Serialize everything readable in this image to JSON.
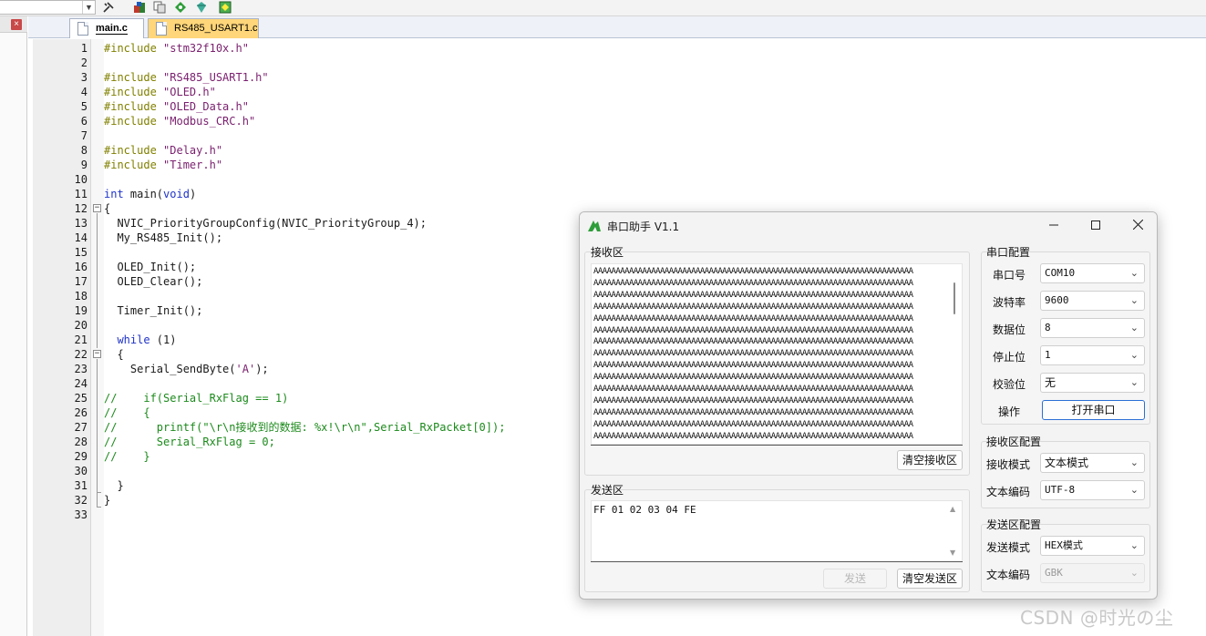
{
  "ide": {
    "tabs": [
      {
        "label": "main.c",
        "active": true
      },
      {
        "label": "RS485_USART1.c",
        "active": false
      }
    ],
    "line_numbers": [
      "1",
      "2",
      "3",
      "4",
      "5",
      "6",
      "7",
      "8",
      "9",
      "10",
      "11",
      "12",
      "13",
      "14",
      "15",
      "16",
      "17",
      "18",
      "19",
      "20",
      "21",
      "22",
      "23",
      "24",
      "25",
      "26",
      "27",
      "28",
      "29",
      "30",
      "31",
      "32",
      "33"
    ],
    "code": {
      "l1a": "#include ",
      "l1b": "\"stm32f10x.h\"",
      "l3a": "#include ",
      "l3b": "\"RS485_USART1.h\"",
      "l4a": "#include ",
      "l4b": "\"OLED.h\"",
      "l5a": "#include ",
      "l5b": "\"OLED_Data.h\"",
      "l6a": "#include ",
      "l6b": "\"Modbus_CRC.h\"",
      "l8a": "#include ",
      "l8b": "\"Delay.h\"",
      "l9a": "#include ",
      "l9b": "\"Timer.h\"",
      "l11a": "int",
      "l11b": " main(",
      "l11c": "void",
      "l11d": ")",
      "l12": "{",
      "l13": "  NVIC_PriorityGroupConfig(NVIC_PriorityGroup_4);",
      "l14": "  My_RS485_Init();",
      "l16": "  OLED_Init();",
      "l17": "  OLED_Clear();",
      "l19": "  Timer_Init();",
      "l21a": "  while",
      "l21b": " (1)",
      "l22": "  {",
      "l23a": "    Serial_SendByte(",
      "l23b": "'A'",
      "l23c": ");",
      "l25": "//    if(Serial_RxFlag == 1)",
      "l26": "//    {",
      "l27": "//      printf(\"\\r\\n接收到的数据: %x!\\r\\n\",Serial_RxPacket[0]);",
      "l28": "//      Serial_RxFlag = 0;",
      "l29": "//    }",
      "l31": "  }",
      "l32": "}"
    }
  },
  "serial": {
    "title": "串口助手 V1.1",
    "receive": {
      "label": "接收区",
      "text": "AAAAAAAAAAAAAAAAAAAAAAAAAAAAAAAAAAAAAAAAAAAAAAAAAAAAAAAAAAAAAAAAAAAAAAAA\nAAAAAAAAAAAAAAAAAAAAAAAAAAAAAAAAAAAAAAAAAAAAAAAAAAAAAAAAAAAAAAAAAAAAAAAA\nAAAAAAAAAAAAAAAAAAAAAAAAAAAAAAAAAAAAAAAAAAAAAAAAAAAAAAAAAAAAAAAAAAAAAAAA\nAAAAAAAAAAAAAAAAAAAAAAAAAAAAAAAAAAAAAAAAAAAAAAAAAAAAAAAAAAAAAAAAAAAAAAAA\nAAAAAAAAAAAAAAAAAAAAAAAAAAAAAAAAAAAAAAAAAAAAAAAAAAAAAAAAAAAAAAAAAAAAAAAA\nAAAAAAAAAAAAAAAAAAAAAAAAAAAAAAAAAAAAAAAAAAAAAAAAAAAAAAAAAAAAAAAAAAAAAAAA\nAAAAAAAAAAAAAAAAAAAAAAAAAAAAAAAAAAAAAAAAAAAAAAAAAAAAAAAAAAAAAAAAAAAAAAAA\nAAAAAAAAAAAAAAAAAAAAAAAAAAAAAAAAAAAAAAAAAAAAAAAAAAAAAAAAAAAAAAAAAAAAAAAA\nAAAAAAAAAAAAAAAAAAAAAAAAAAAAAAAAAAAAAAAAAAAAAAAAAAAAAAAAAAAAAAAAAAAAAAAA\nAAAAAAAAAAAAAAAAAAAAAAAAAAAAAAAAAAAAAAAAAAAAAAAAAAAAAAAAAAAAAAAAAAAAAAAA\nAAAAAAAAAAAAAAAAAAAAAAAAAAAAAAAAAAAAAAAAAAAAAAAAAAAAAAAAAAAAAAAAAAAAAAAA\nAAAAAAAAAAAAAAAAAAAAAAAAAAAAAAAAAAAAAAAAAAAAAAAAAAAAAAAAAAAAAAAAAAAAAAAA\nAAAAAAAAAAAAAAAAAAAAAAAAAAAAAAAAAAAAAAAAAAAAAAAAAAAAAAAAAAAAAAAAAAAAAAAA\nAAAAAAAAAAAAAAAAAAAAAAAAAAAAAAAAAAAAAAAAAAAAAAAAAAAAAAAAAAAAAAAAAAAAAAAA\nAAAAAAAAAAAAAAAAAAAAAAAAAAAAAAAAAAAAAAAAAAAAAAAAAAAAAAAAAAAAAAAAAAAAAAAA",
      "clear_button": "清空接收区"
    },
    "send": {
      "label": "发送区",
      "text": "FF 01 02 03 04 FE",
      "send_button": "发送",
      "clear_button": "清空发送区"
    },
    "port_config": {
      "label": "串口配置",
      "port_label": "串口号",
      "port_value": "COM10",
      "baud_label": "波特率",
      "baud_value": "9600",
      "databits_label": "数据位",
      "databits_value": "8",
      "stopbits_label": "停止位",
      "stopbits_value": "1",
      "parity_label": "校验位",
      "parity_value": "无",
      "action_label": "操作",
      "open_button": "打开串口"
    },
    "rx_config": {
      "label": "接收区配置",
      "mode_label": "接收模式",
      "mode_value": "文本模式",
      "encoding_label": "文本编码",
      "encoding_value": "UTF-8"
    },
    "tx_config": {
      "label": "发送区配置",
      "mode_label": "发送模式",
      "mode_value": "HEX模式",
      "encoding_label": "文本编码",
      "encoding_value": "GBK"
    }
  },
  "watermark": "CSDN @时光の尘",
  "colors": {
    "preprocessor": "#808000",
    "string": "#7a1f6e",
    "keyword": "#1f33c8",
    "comment": "#1c8a1c",
    "active_tab_bg": "#ffffff",
    "inactive_tab_bg": "#ffd679",
    "primary_button_border": "#2b6fd6"
  }
}
